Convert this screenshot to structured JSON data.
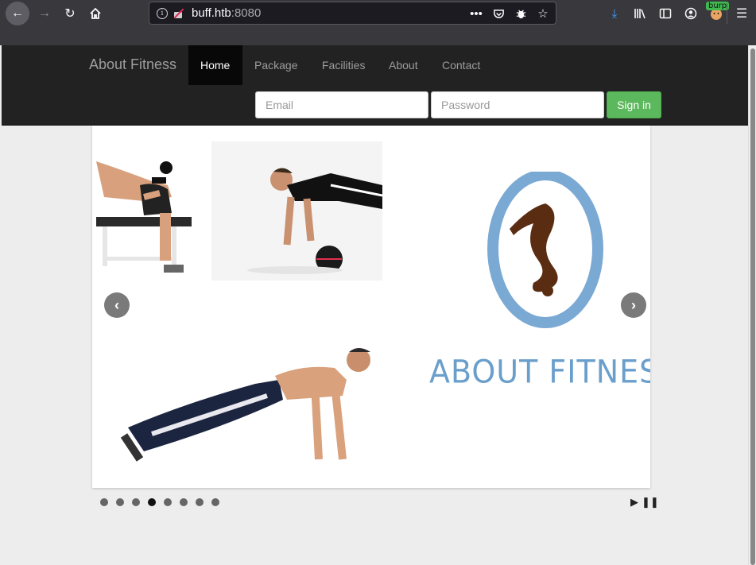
{
  "browser": {
    "url_host": "buff.htb",
    "url_port": ":8080",
    "burp_badge": "burp"
  },
  "site": {
    "brand": "About Fitness",
    "nav": {
      "home": "Home",
      "package": "Package",
      "facilities": "Facilities",
      "about": "About",
      "contact": "Contact"
    },
    "login": {
      "email_placeholder": "Email",
      "password_placeholder": "Password",
      "signin_label": "Sign in"
    }
  },
  "slider": {
    "logo_text": "ABOUT FITNESS",
    "dots_count": 8,
    "active_dot": 4
  }
}
